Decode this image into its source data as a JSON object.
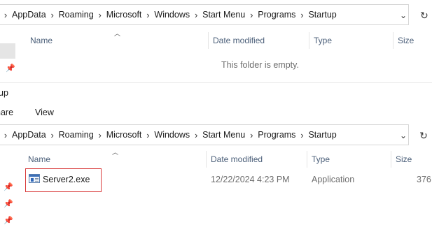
{
  "top_window": {
    "breadcrumb": [
      "AppData",
      "Roaming",
      "Microsoft",
      "Windows",
      "Start Menu",
      "Programs",
      "Startup"
    ],
    "columns": {
      "name": "Name",
      "date_modified": "Date modified",
      "type": "Type",
      "size": "Size"
    },
    "empty_message": "This folder is empty."
  },
  "bottom_window": {
    "title": "up",
    "ribbon": {
      "share": "hare",
      "view": "View"
    },
    "breadcrumb": [
      "AppData",
      "Roaming",
      "Microsoft",
      "Windows",
      "Start Menu",
      "Programs",
      "Startup"
    ],
    "columns": {
      "name": "Name",
      "date_modified": "Date modified",
      "type": "Type",
      "size": "Size"
    },
    "files": [
      {
        "name": "Server2.exe",
        "date_modified": "12/22/2024 4:23 PM",
        "type": "Application",
        "size": "376"
      }
    ]
  },
  "icons": {
    "separator": "chevron-right-icon",
    "dropdown": "chevron-down-icon",
    "refresh": "refresh-icon",
    "pin": "pin-icon",
    "sort": "sort-ascending-icon",
    "file": "application-icon"
  },
  "colors": {
    "highlight_border": "#d93b3b",
    "header_text": "#4c607a"
  }
}
